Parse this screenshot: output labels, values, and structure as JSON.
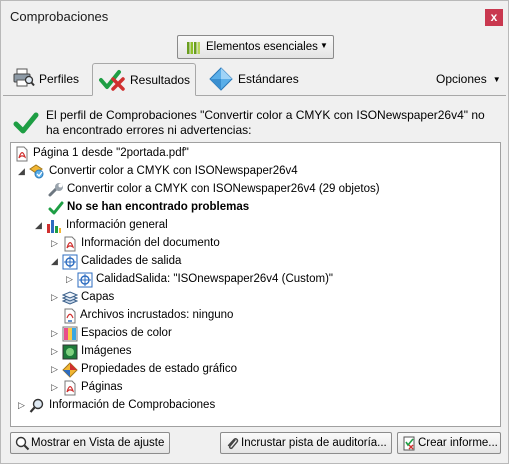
{
  "window": {
    "title": "Comprobaciones",
    "close_label": "x"
  },
  "profile_selector": {
    "label": "Elementos esenciales"
  },
  "tabs": [
    {
      "label": "Perfiles"
    },
    {
      "label": "Resultados"
    },
    {
      "label": "Estándares"
    }
  ],
  "options_label": "Opciones",
  "message": "El perfil de Comprobaciones \"Convertir color a CMYK con ISONewspaper26v4\" no ha encontrado errores ni advertencias:",
  "tree": {
    "items": [
      {
        "label": "Página 1 desde \"2portada.pdf\""
      },
      {
        "label": "Convertir color a CMYK con ISONewspaper26v4"
      },
      {
        "label": "Convertir color a CMYK con ISONewspaper26v4 (29 objetos)"
      },
      {
        "label": "No se han encontrado problemas"
      },
      {
        "label": "Información general"
      },
      {
        "label": "Información del documento"
      },
      {
        "label": "Calidades de salida"
      },
      {
        "label": "CalidadSalida: \"ISOnewspaper26v4 (Custom)\""
      },
      {
        "label": "Capas"
      },
      {
        "label": "Archivos incrustados: ninguno"
      },
      {
        "label": "Espacios de color"
      },
      {
        "label": "Imágenes"
      },
      {
        "label": "Propiedades de estado gráfico"
      },
      {
        "label": "Páginas"
      },
      {
        "label": "Información de Comprobaciones"
      }
    ]
  },
  "buttons": {
    "show_label": "Mostrar en Vista de ajuste",
    "embed_label": "Incrustar pista de auditoría...",
    "report_label": "Crear informe..."
  },
  "colors": {
    "accent_green": "#1e9e44",
    "pdf_red": "#d0302f",
    "close_red": "#c9384f"
  }
}
